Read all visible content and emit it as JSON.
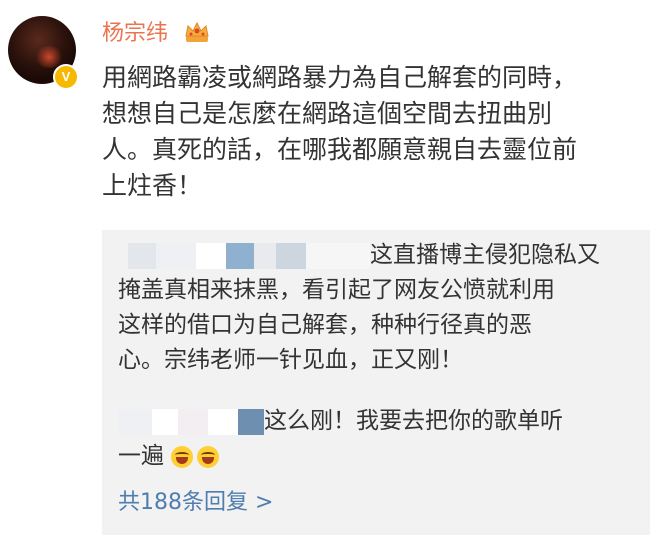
{
  "post": {
    "username": "杨宗纬",
    "verified_badge": "V",
    "crown_icon": "crown-icon",
    "text_lines": [
      "用網路霸凌或網路暴力為自己解套的同時，",
      "想想自己是怎麼在網路這個空間去扭曲別",
      "人。真死的話，在哪我都願意親自去靈位前",
      "上炷香！"
    ]
  },
  "replies": {
    "reply1_lines": [
      "这直播博主侵犯隐私又",
      "掩盖真相来抹黑，看引起了网友公愤就利用",
      "这样的借口为自己解套，种种行径真的恶",
      "心。宗纬老师一针见血，正又刚！"
    ],
    "reply2_lines": [
      "这么刚！我要去把你的歌单听",
      "一遍"
    ],
    "emoji_icon": "laugh-cry-emoji-icon",
    "total_replies_label": "共188条回复 >"
  },
  "colors": {
    "username": "#eb7350",
    "link": "#507daf",
    "text": "#333333",
    "reply_bg": "#f2f2f2",
    "badge": "#f7b900"
  }
}
